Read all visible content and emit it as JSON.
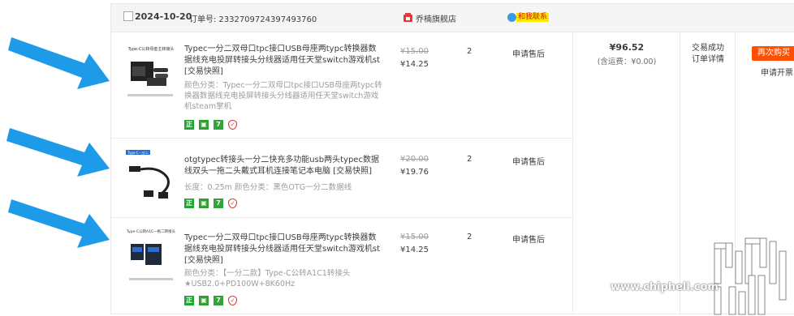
{
  "order": {
    "date": "2024-10-20",
    "order_no_label": "订单号:",
    "order_no": "2332709724397493760",
    "shop_name": "乔楠旗舰店",
    "contact_label": "和我联系",
    "total": "¥96.52",
    "shipping": "(含运费：¥0.00)",
    "status": "交易成功",
    "detail_link": "订单详情",
    "rebuy_label": "再次购买",
    "invoice_label": "申请开票"
  },
  "items": [
    {
      "title": "Typec一分二双母口tpc接口USB母座两typc转换器数据线充电投屏转接头分线器适用任天堂switch游戏机st [交易快照]",
      "attr": "颜色分类：Typec一分二双母口tpc接口USB母座两typc转换器数据线充电投屏转接头分线器适用任天堂switch游戏机steam掌机",
      "original_price": "¥15.00",
      "price": "¥14.25",
      "qty": "2",
      "after_sale": "申请售后",
      "thumb_caption": "Type-C公转母金主转接头"
    },
    {
      "title": "otgtypec转接头一分二快充多功能usb两头typec数据线双头一拖二头戴式耳机连接笔记本电脑 [交易快照]",
      "attr": "长度：0.25m  颜色分类：黑色OTG一分二数据线",
      "original_price": "¥20.00",
      "price": "¥19.76",
      "qty": "2",
      "after_sale": "申请售后",
      "thumb_caption": "Type-C一分二"
    },
    {
      "title": "Typec一分二双母口tpc接口USB母座两typc转换器数据线充电投屏转接头分线器适用任天堂switch游戏机st [交易快照]",
      "attr": "颜色分类：【一分二款】Type-C公转A1C1转接头★USB2.0+PD100W+8K60Hz",
      "original_price": "¥15.00",
      "price": "¥14.25",
      "qty": "2",
      "after_sale": "申请售后",
      "thumb_caption": "Type-C公转A1C一拖二转接头"
    }
  ],
  "badges": {
    "zheng": "正",
    "seven": "7"
  },
  "watermark": {
    "url": "www.chiphell.com"
  },
  "colors": {
    "arrow": "#1e9be8",
    "rebuy": "#ff4f00",
    "contact_bg": "#ffe800"
  }
}
